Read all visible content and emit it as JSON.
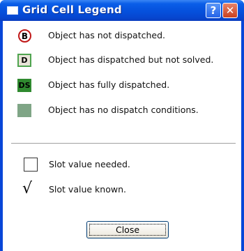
{
  "window": {
    "title": "Grid Cell Legend",
    "help_glyph": "?",
    "close_glyph": "✕"
  },
  "legend": [
    {
      "symbol": "B",
      "icon": "red-circle-icon",
      "label": "Object has not dispatched."
    },
    {
      "symbol": "D",
      "icon": "green-outline-square-icon",
      "label": "Object has dispatched but not solved."
    },
    {
      "symbol": "DS",
      "icon": "green-filled-square-icon",
      "label": "Object has fully dispatched."
    },
    {
      "symbol": "",
      "icon": "grey-green-square-icon",
      "label": "Object has no dispatch conditions."
    }
  ],
  "slots": [
    {
      "symbol": "",
      "icon": "empty-box-icon",
      "label": "Slot value needed."
    },
    {
      "symbol": "√",
      "icon": "checkmark-icon",
      "label": "Slot value known."
    }
  ],
  "buttons": {
    "close": "Close"
  },
  "colors": {
    "title_bar": "#0550dc",
    "not_dispatched_ring": "#c01818",
    "dispatched_outline": "#4fa44f",
    "fully_dispatched": "#2f8a2f",
    "no_conditions": "#7fa586"
  }
}
